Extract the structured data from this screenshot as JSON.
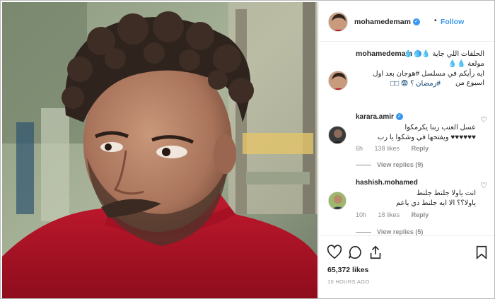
{
  "post": {
    "username": "mohamedemam",
    "follow_label": "Follow",
    "separator": "•",
    "verified_icon": "✓"
  },
  "caption": {
    "username": "mohamedemam",
    "text": "الحلقات اللي جاية 💧💧💧",
    "text2": "مولعة 💧💧",
    "text3": "ايه رأيكم في مسلسل #هوجان بعد اول اسبوع من",
    "text4": "#رمضان ؟ 😨 □□"
  },
  "comments": [
    {
      "username": "karara.amir",
      "text": "عسل العنب ربنا يكرمكوا",
      "text2": "♥♥♥♥♥♥ ويفتحها في وشكوا يا رب",
      "age": "6h",
      "likes": "138 likes",
      "reply": "Reply",
      "view_replies": "View replies (9)"
    },
    {
      "username": "hashish.mohamed",
      "text": "انت ياولا جلنط جلنط",
      "text2": "ياولا؟؟ الا ايه جلنط دي ياعم",
      "age": "10h",
      "likes": "18 likes",
      "reply": "Reply",
      "view_replies": "View replies (5)"
    }
  ],
  "footer": {
    "likes": "65,372 likes",
    "time": "10 HOURS AGO"
  },
  "colors": {
    "link_blue": "#3897f0",
    "sweater_red": "#b81428"
  }
}
